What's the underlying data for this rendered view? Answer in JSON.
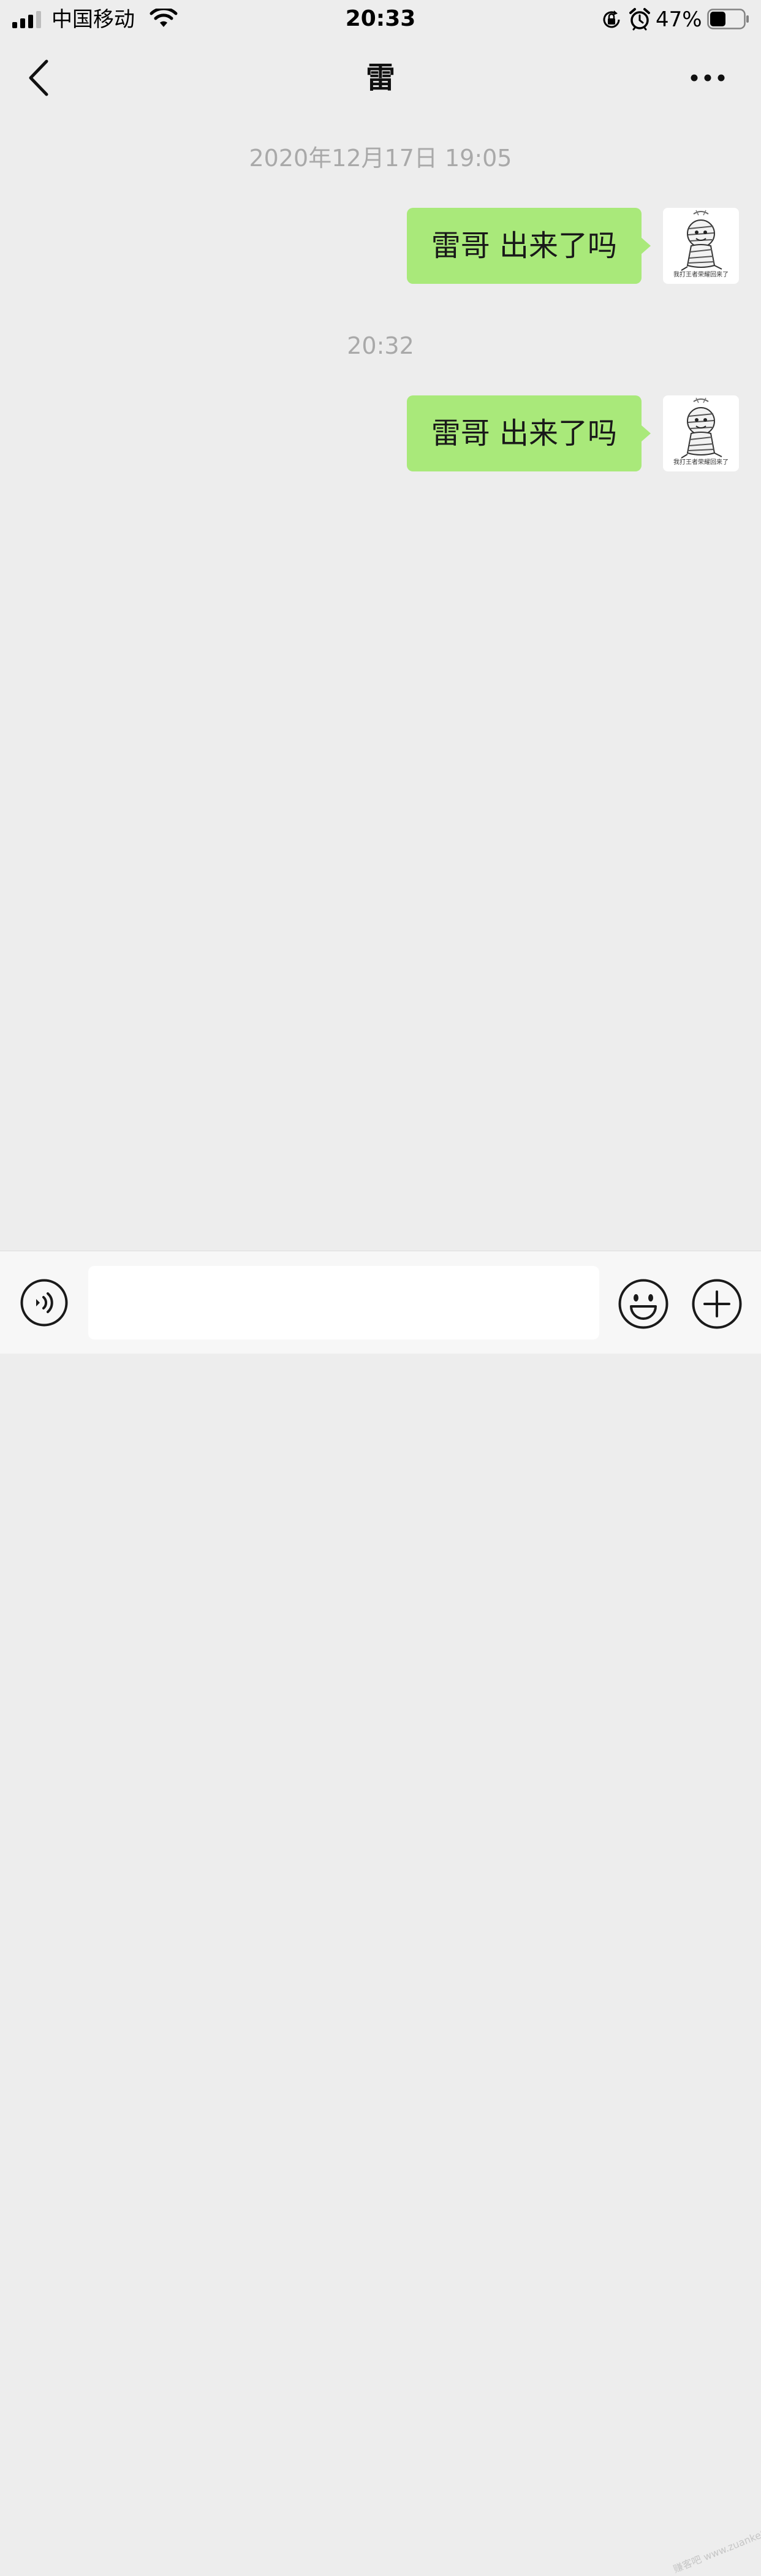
{
  "status_bar": {
    "carrier": "中国移动",
    "time": "20:33",
    "battery_percent": "47%",
    "battery_level": 0.47
  },
  "nav": {
    "title": "雷"
  },
  "chat": {
    "messages": [
      {
        "timestamp": "2020年12月17日 19:05",
        "text": "雷哥 出来了吗",
        "avatar_caption": "我打王者荣耀回来了"
      },
      {
        "timestamp": "20:32",
        "text": "雷哥 出来了吗",
        "avatar_caption": "我打王者荣耀回来了"
      }
    ]
  },
  "input_bar": {
    "value": "",
    "watermark": "赚客吧 www.zuanke8.com"
  },
  "colors": {
    "background": "#ededed",
    "bubble_outgoing": "#a9e97a",
    "timestamp_text": "#a9a9a9",
    "input_bar_bg": "#f7f7f7"
  },
  "icons": {
    "back": "chevron-left-icon",
    "more": "more-dots-icon",
    "voice": "voice-icon",
    "emoji": "emoji-icon",
    "plus": "plus-icon"
  }
}
